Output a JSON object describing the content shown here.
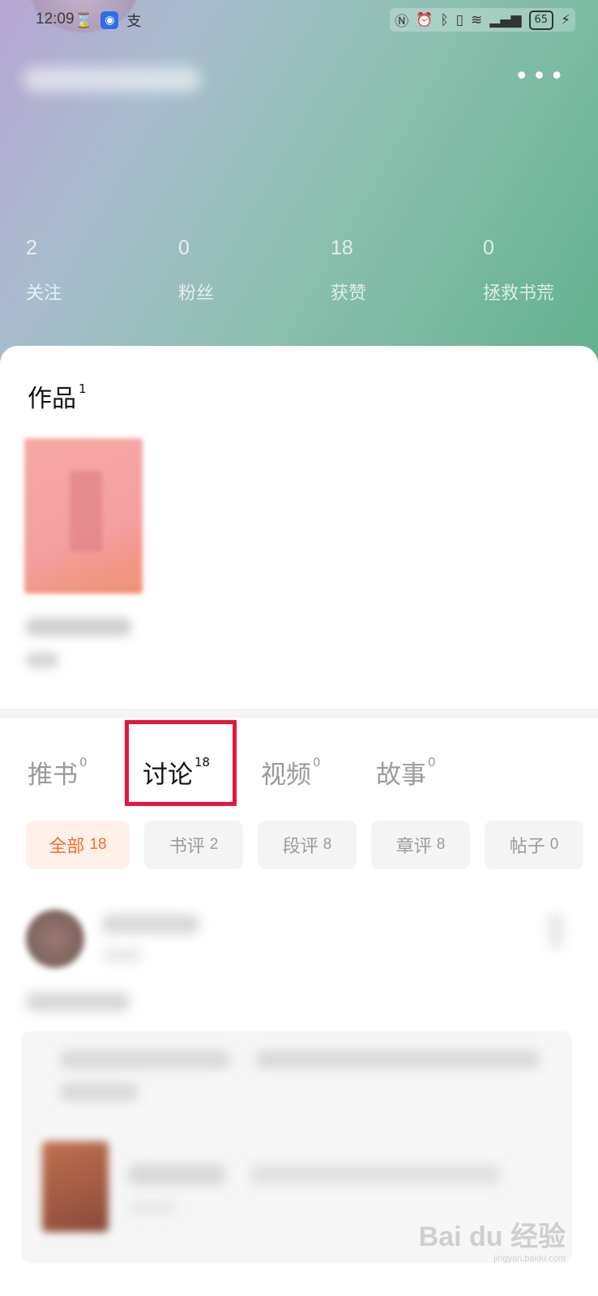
{
  "status_bar": {
    "time": "12:09",
    "battery": "65"
  },
  "stats": [
    {
      "value": "2",
      "label": "关注"
    },
    {
      "value": "0",
      "label": "粉丝"
    },
    {
      "value": "18",
      "label": "获赞"
    },
    {
      "value": "0",
      "label": "拯救书荒"
    }
  ],
  "works": {
    "title": "作品",
    "count": "1"
  },
  "tabs": [
    {
      "label": "推书",
      "count": "0"
    },
    {
      "label": "讨论",
      "count": "18"
    },
    {
      "label": "视频",
      "count": "0"
    },
    {
      "label": "故事",
      "count": "0"
    }
  ],
  "filters": [
    {
      "label": "全部",
      "count": "18"
    },
    {
      "label": "书评",
      "count": "2"
    },
    {
      "label": "段评",
      "count": "8"
    },
    {
      "label": "章评",
      "count": "8"
    },
    {
      "label": "帖子",
      "count": "0"
    }
  ],
  "watermark": {
    "text": "Bai du 经验",
    "url": "jingyan.baidu.com"
  },
  "colors": {
    "accent": "#f07030",
    "highlight": "#e5173d"
  }
}
